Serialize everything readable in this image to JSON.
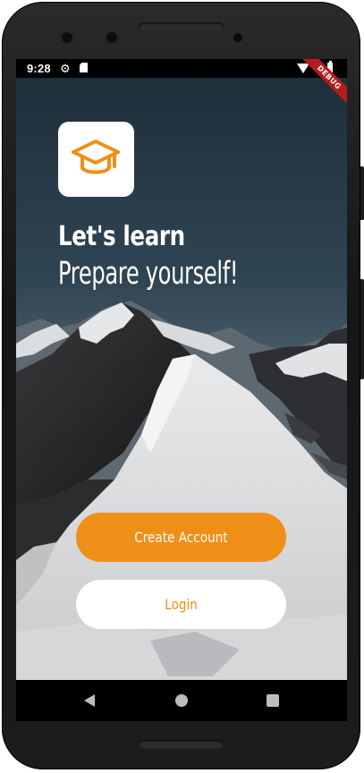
{
  "status_bar": {
    "time": "9:28",
    "icons": [
      "gear-icon",
      "sd-card-icon",
      "wifi-icon",
      "battery-icon"
    ]
  },
  "debug_banner": "DEBUG",
  "hero": {
    "logo_icon": "graduation-cap-icon",
    "title": "Let's learn",
    "subtitle": "Prepare yourself!"
  },
  "actions": {
    "create_account": "Create Account",
    "login": "Login"
  },
  "nav_bar": {
    "icons": [
      "back-icon",
      "home-icon",
      "recents-icon"
    ]
  },
  "colors": {
    "accent": "#EF8F17",
    "button_light": "#FFFFFF",
    "status_bar": "#000000"
  }
}
